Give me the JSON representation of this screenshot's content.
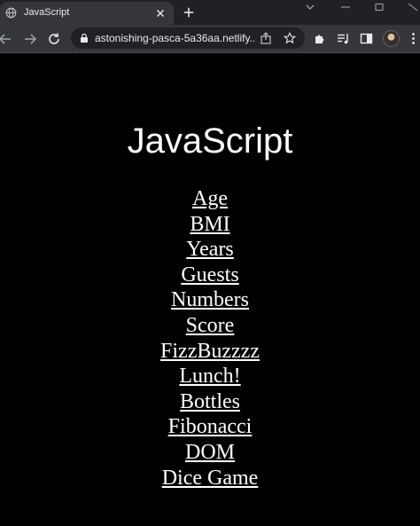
{
  "browser": {
    "tab": {
      "title": "JavaScript"
    },
    "address_bar": {
      "url": "astonishing-pasca-5a36aa.netlify..."
    }
  },
  "page": {
    "heading": "JavaScript",
    "links": [
      {
        "label": "Age"
      },
      {
        "label": "BMI"
      },
      {
        "label": "Years"
      },
      {
        "label": "Guests"
      },
      {
        "label": "Numbers"
      },
      {
        "label": "Score"
      },
      {
        "label": "FizzBuzzzz"
      },
      {
        "label": "Lunch!"
      },
      {
        "label": "Bottles"
      },
      {
        "label": "Fibonacci"
      },
      {
        "label": "DOM"
      },
      {
        "label": "Dice Game"
      }
    ]
  },
  "colors": {
    "page_background": "#000000",
    "text": "#ffffff",
    "chrome_tabstrip": "#202124",
    "chrome_toolbar": "#35363a"
  }
}
